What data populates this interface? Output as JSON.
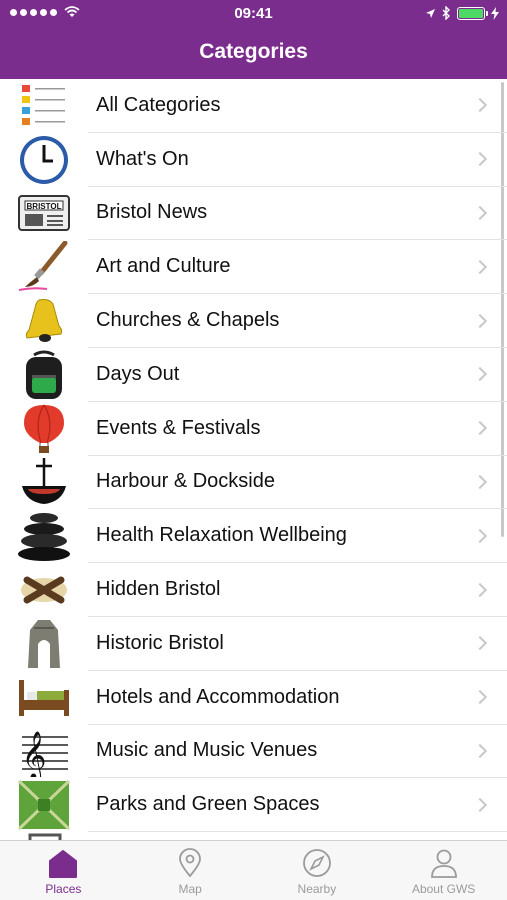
{
  "status_bar": {
    "time": "09:41"
  },
  "nav": {
    "title": "Categories"
  },
  "categories": [
    {
      "label": "All Categories",
      "icon": "list-icon"
    },
    {
      "label": "What's On",
      "icon": "clock-icon"
    },
    {
      "label": "Bristol News",
      "icon": "newspaper-icon"
    },
    {
      "label": "Art and Culture",
      "icon": "paintbrush-icon"
    },
    {
      "label": "Churches & Chapels",
      "icon": "bell-icon"
    },
    {
      "label": "Days Out",
      "icon": "backpack-icon"
    },
    {
      "label": "Events & Festivals",
      "icon": "balloon-icon"
    },
    {
      "label": "Harbour & Dockside",
      "icon": "boat-icon"
    },
    {
      "label": "Health Relaxation Wellbeing",
      "icon": "stones-icon"
    },
    {
      "label": "Hidden Bristol",
      "icon": "treasure-x-icon"
    },
    {
      "label": "Historic Bristol",
      "icon": "arch-icon"
    },
    {
      "label": "Hotels and Accommodation",
      "icon": "bed-icon"
    },
    {
      "label": "Music and Music Venues",
      "icon": "treble-clef-icon"
    },
    {
      "label": "Parks and Green Spaces",
      "icon": "park-icon"
    }
  ],
  "tabbar": [
    {
      "label": "Places",
      "icon": "house-icon",
      "active": true
    },
    {
      "label": "Map",
      "icon": "map-pin-icon",
      "active": false
    },
    {
      "label": "Nearby",
      "icon": "compass-icon",
      "active": false
    },
    {
      "label": "About GWS",
      "icon": "person-icon",
      "active": false
    }
  ],
  "colors": {
    "brand": "#7b2d8e",
    "separator": "#e2e2e2",
    "chevron": "#c7c7cc",
    "tab_inactive": "#9b9b9b",
    "battery": "#4cd964"
  }
}
